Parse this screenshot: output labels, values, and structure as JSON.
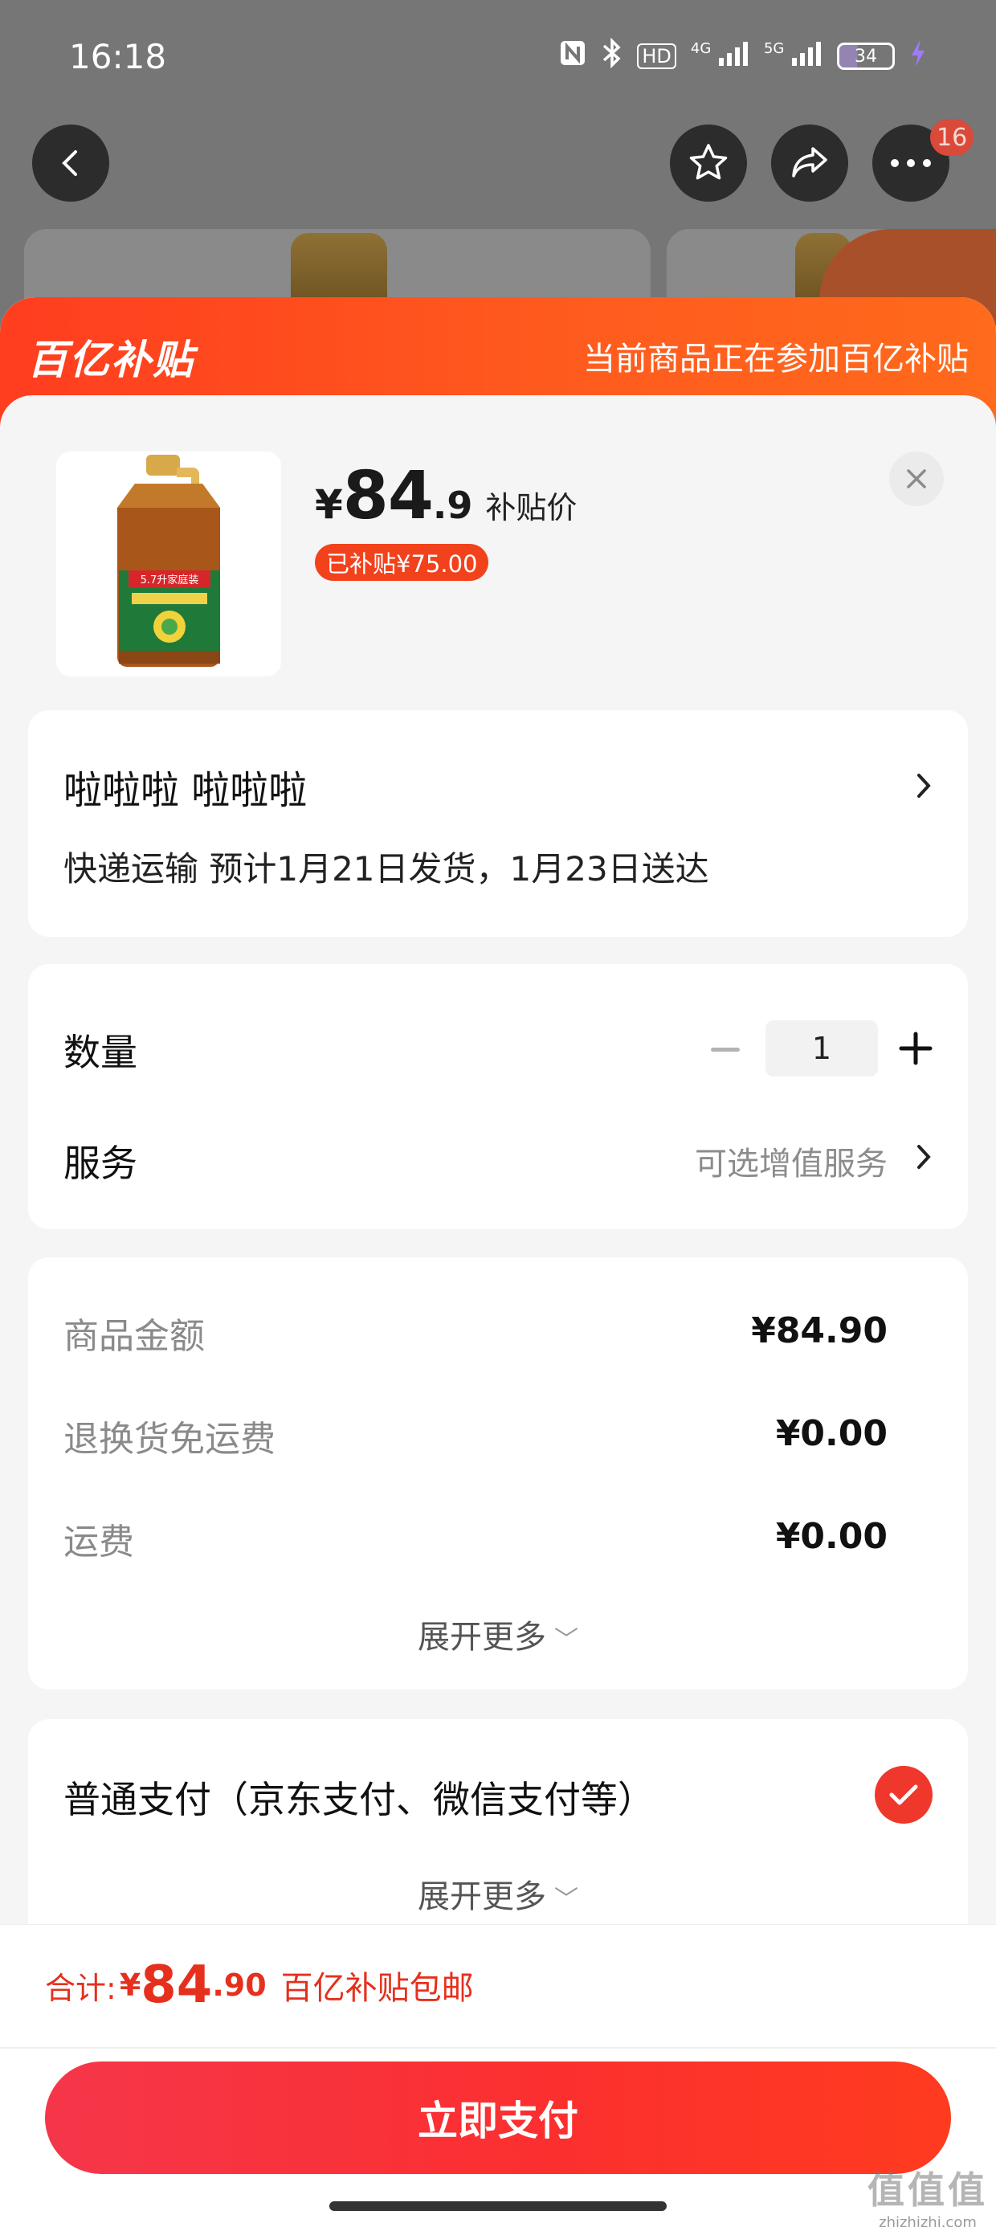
{
  "status_bar": {
    "time": "16:18",
    "icons": [
      "nfc-icon",
      "bluetooth-icon",
      "hd-icon",
      "signal-4g-icon",
      "signal-5g-icon",
      "battery-icon",
      "charging-icon"
    ],
    "hd_label": "HD",
    "net1": "4G",
    "net2": "5G",
    "battery": "34"
  },
  "top_nav": {
    "cart_badge": "16"
  },
  "banner": {
    "logo_text": "百亿补贴",
    "text": "当前商品正在参加百亿补贴",
    "color": "#ff4a1e"
  },
  "product": {
    "price_currency": "¥",
    "price_int": "84",
    "price_dec": ".9",
    "price_tag": "补贴价",
    "subsidy": "已补贴¥75.00",
    "bottle_label": "5.7升家庭装"
  },
  "address": {
    "name": "啦啦啦  啦啦啦",
    "shipping": "快递运输 预计1月21日发货，1月23日送达"
  },
  "quantity": {
    "label": "数量",
    "value": "1"
  },
  "service": {
    "label": "服务",
    "value": "可选增值服务"
  },
  "amounts": {
    "rows": [
      {
        "label": "商品金额",
        "value": "¥84.90"
      },
      {
        "label": "退换货免运费",
        "value": "¥0.00"
      },
      {
        "label": "运费",
        "value": "¥0.00"
      }
    ],
    "expand": "展开更多"
  },
  "payment": {
    "method": "普通支付（京东支付、微信支付等）",
    "expand": "展开更多"
  },
  "footer": {
    "total_label": "合计:",
    "total_currency": "¥",
    "total_int": "84",
    "total_dec": ".90",
    "total_note": "百亿补贴包邮",
    "pay_button": "立即支付",
    "accent": "#f5302a"
  },
  "watermark": {
    "logo": "值值值",
    "url": "zhizhizhi.com"
  }
}
